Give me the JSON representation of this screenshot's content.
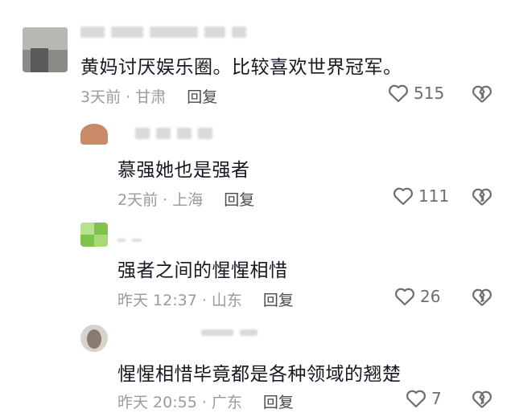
{
  "comments": [
    {
      "text": "黄妈讨厌娱乐圈。比较喜欢世界冠军。",
      "time_location": "3天前 · 甘肃",
      "reply_label": "回复",
      "likes": "515",
      "avatar_color": "#7c7c78"
    },
    {
      "text": "慕强她也是强者",
      "time_location": "2天前 · 上海",
      "reply_label": "回复",
      "likes": "111",
      "avatar_color": "#c98a67"
    },
    {
      "text": "强者之间的惺惺相惜",
      "time_location": "昨天 12:37 · 山东",
      "reply_label": "回复",
      "likes": "26",
      "avatar_color": "#7fc44a"
    },
    {
      "text": "惺惺相惜毕竟都是各种领域的翘楚",
      "time_location": "昨天 20:55 · 广东",
      "reply_label": "回复",
      "likes": "7",
      "avatar_color": "#8a7a70"
    }
  ],
  "icons": {
    "like": "heart-outline-icon",
    "dislike": "broken-heart-icon"
  }
}
